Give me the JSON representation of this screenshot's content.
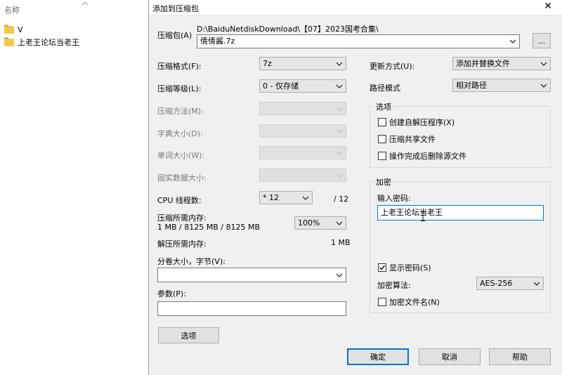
{
  "explorer": {
    "header": "名称",
    "items": [
      {
        "name": "V",
        "icon": "folder-icon"
      },
      {
        "name": "上老王论坛当老王",
        "icon": "folder-icon"
      }
    ]
  },
  "dialog": {
    "title": "添加到压缩包",
    "close": "✕",
    "archive": {
      "label": "压缩包(A)",
      "path": "D:\\BaiduNetdiskDownload\\【07】2023国考合集\\",
      "value": "倩倩酱.7z",
      "browse": "..."
    },
    "left": {
      "format": {
        "label": "压缩格式(F):",
        "value": "7z"
      },
      "level": {
        "label": "压缩等级(L):",
        "value": "0 - 仅存储"
      },
      "method": {
        "label": "压缩方法(M):",
        "value": ""
      },
      "dict": {
        "label": "字典大小(D):",
        "value": ""
      },
      "word": {
        "label": "单词大小(W):",
        "value": ""
      },
      "solid": {
        "label": "固实数据大小:",
        "value": ""
      },
      "threads": {
        "label": "CPU 线程数:",
        "value": "* 12",
        "max": "/ 12"
      },
      "mem_comp": {
        "label": "压缩所需内存:",
        "detail": "1 MB / 8125 MB / 8125 MB",
        "value": "100%"
      },
      "mem_decomp": {
        "label": "解压所需内存:",
        "value": "1 MB"
      },
      "volume": {
        "label": "分卷大小，字节(V):",
        "value": ""
      },
      "params": {
        "label": "参数(P):",
        "value": ""
      },
      "options_button": "选项"
    },
    "right": {
      "update": {
        "label": "更新方式(U):",
        "value": "添加并替换文件"
      },
      "pathmode": {
        "label": "路径模式",
        "value": "相对路径"
      },
      "options": {
        "title": "选项",
        "sfx": {
          "label": "创建自解压程序(X)",
          "checked": false
        },
        "shared": {
          "label": "压缩共享文件",
          "checked": false
        },
        "delete": {
          "label": "操作完成后删除源文件",
          "checked": false
        }
      },
      "encryption": {
        "title": "加密",
        "pw_label": "输入密码:",
        "pw_value": "上老王论坛当老王",
        "show_pw": {
          "label": "显示密码(S)",
          "checked": true
        },
        "method_label": "加密算法:",
        "method_value": "AES-256",
        "encrypt_names": {
          "label": "加密文件名(N)",
          "checked": false
        }
      }
    },
    "buttons": {
      "ok": "确定",
      "cancel": "取消",
      "help": "帮助"
    }
  }
}
